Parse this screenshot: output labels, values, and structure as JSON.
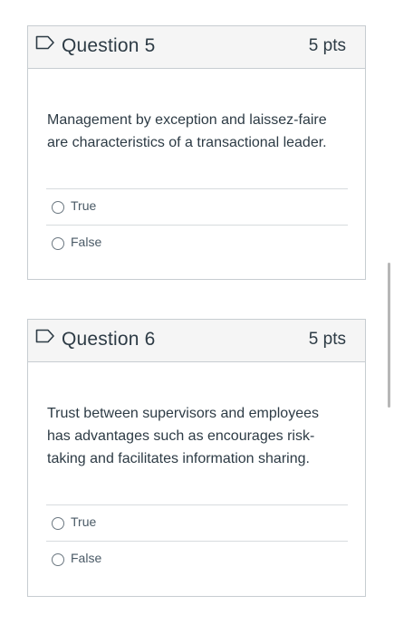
{
  "questions": [
    {
      "title": "Question 5",
      "points": "5 pts",
      "text": "Management by exception and laissez-faire are characteristics of a transactional leader.",
      "answers": [
        "True",
        "False"
      ]
    },
    {
      "title": "Question 6",
      "points": "5 pts",
      "text": "Trust between supervisors and employees has advantages such as encourages risk-taking and facilitates information sharing.",
      "answers": [
        "True",
        "False"
      ]
    }
  ],
  "colors": {
    "header_bg": "#f5f5f5",
    "border": "#c7cdd1",
    "text": "#2d3b45",
    "flag_icon": "#2d3b45"
  },
  "icons": {
    "flag": "flag-question-icon",
    "radio": "radio-button-icon"
  }
}
